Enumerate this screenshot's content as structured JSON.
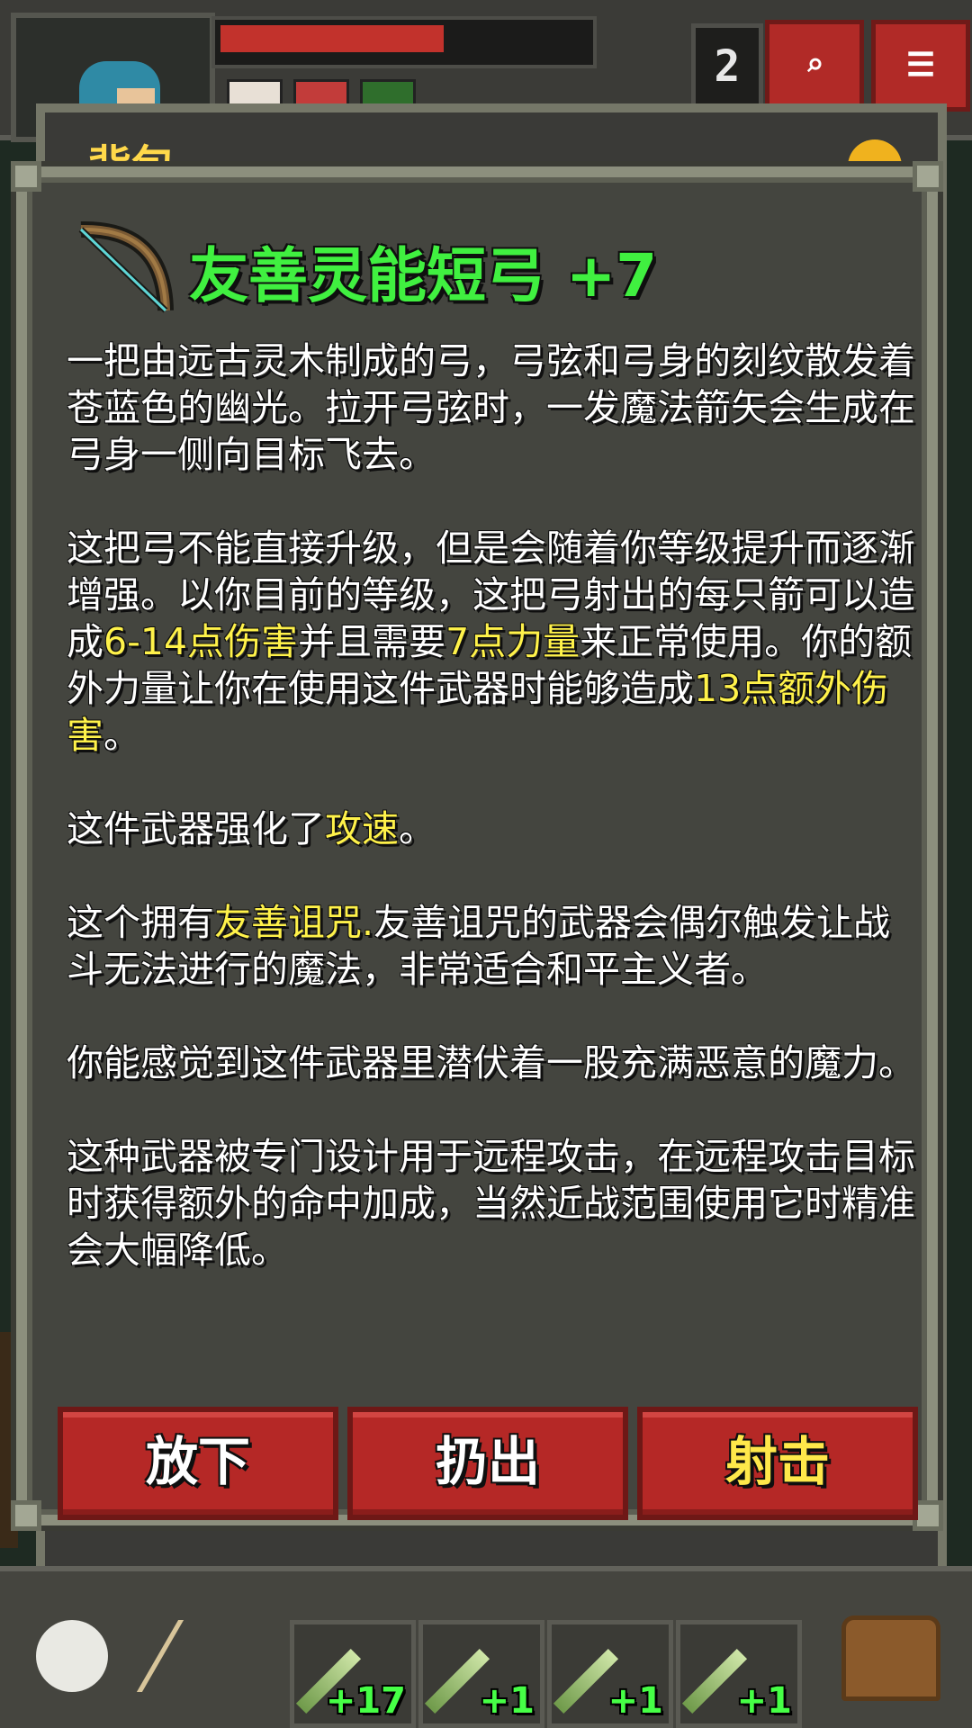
{
  "hud": {
    "depth": "2",
    "hp_fraction": 0.62,
    "search_icon": "search-icon",
    "menu_icon": "menu-icon"
  },
  "bag": {
    "title": "背包"
  },
  "item": {
    "icon": "bow-icon",
    "title": "友善灵能短弓 +7",
    "title_color": "#40f040",
    "highlight_color": "#fff24a",
    "desc": {
      "p1": "一把由远古灵木制成的弓，弓弦和弓身的刻纹散发着苍蓝色的幽光。拉开弓弦时，一发魔法箭矢会生成在弓身一侧向目标飞去。",
      "p2_a": "这把弓不能直接升级，但是会随着你等级提升而逐渐增强。以你目前的等级，这把弓射出的每只箭可以造成",
      "p2_hl1": "6-14点伤害",
      "p2_b": "并且需要",
      "p2_hl2": "7点力量",
      "p2_c": "来正常使用。你的额外力量让你在使用这件武器时能够造成",
      "p2_hl3": "13点额外伤害",
      "p2_d": "。",
      "p3_a": "这件武器强化了",
      "p3_hl": "攻速",
      "p3_b": "。",
      "p4_a": "这个拥有",
      "p4_hl": "友善诅咒.",
      "p4_b": "友善诅咒的武器会偶尔触发让战斗无法进行的魔法，非常适合和平主义者。",
      "p5": "你能感觉到这件武器里潜伏着一股充满恶意的魔力。",
      "p6": "这种武器被专门设计用于远程攻击，在远程攻击目标时获得额外的命中加成，当然近战范围使用它时精准会大幅降低。"
    }
  },
  "actions": {
    "drop": "放下",
    "throw": "扔出",
    "shoot": "射击"
  },
  "quickslots": [
    {
      "icon": "wand-icon",
      "qty": "+17"
    },
    {
      "icon": "wand-icon",
      "qty": "+1"
    },
    {
      "icon": "wand-icon",
      "qty": "+1"
    },
    {
      "icon": "wand-icon",
      "qty": "+1"
    }
  ]
}
